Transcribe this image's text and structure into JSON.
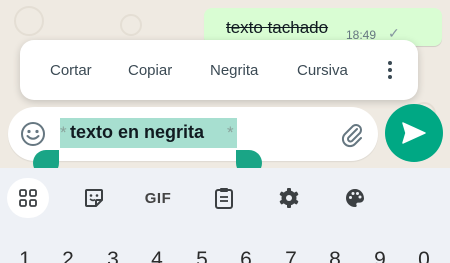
{
  "message": {
    "text": "texto tachado",
    "time": "18:49",
    "status_icon": "single-check-icon"
  },
  "context_menu": {
    "items": [
      "Cortar",
      "Copiar",
      "Negrita",
      "Cursiva"
    ],
    "more_icon": "more-vertical-icon"
  },
  "composer": {
    "prefix": "*",
    "selected_text": "texto en negrita",
    "suffix": "*",
    "emoji_icon": "emoji-icon",
    "attach_icon": "paperclip-icon",
    "send_icon": "send-icon"
  },
  "keyboard": {
    "toolbar": [
      "grid-apps-icon",
      "sticker-icon",
      "GIF",
      "clipboard-icon",
      "settings-icon",
      "palette-icon"
    ],
    "gif_label": "GIF",
    "number_row": [
      "1",
      "2",
      "3",
      "4",
      "5",
      "6",
      "7",
      "8",
      "9",
      "0"
    ]
  },
  "colors": {
    "accent": "#00a884",
    "selection": "#a7dfd0",
    "bubble": "#d9fdd3",
    "chat_bg": "#efeae2",
    "keyboard_bg": "#eef1f6"
  }
}
